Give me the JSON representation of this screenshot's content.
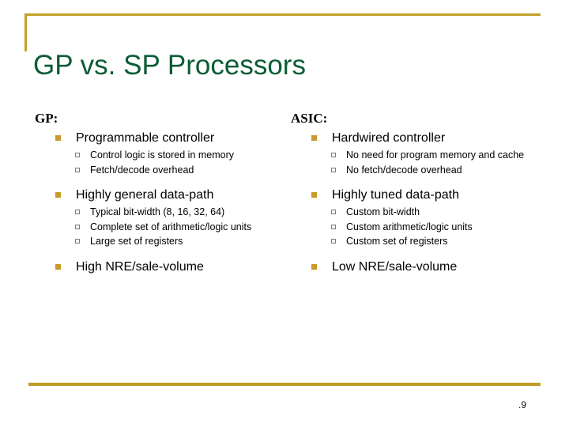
{
  "slide": {
    "title": "GP vs. SP Processors",
    "page_number": ".9",
    "accent_gold": "#C2A02A",
    "title_green": "#0B5C36",
    "bullet_gold": "#C9992B",
    "bullet_outline": "#6E8A6A"
  },
  "columns": {
    "left": {
      "heading": "GP:",
      "groups": [
        {
          "title": "Programmable controller",
          "subs": [
            "Control logic is stored in memory",
            "Fetch/decode overhead"
          ]
        },
        {
          "title": "Highly general data-path",
          "subs": [
            "Typical bit-width (8, 16, 32, 64)",
            "Complete set of arithmetic/logic units",
            "Large set of registers"
          ]
        },
        {
          "title": "High NRE/sale-volume",
          "subs": []
        }
      ]
    },
    "right": {
      "heading": "ASIC:",
      "groups": [
        {
          "title": "Hardwired controller",
          "subs": [
            "No need for program memory and cache",
            "No fetch/decode overhead"
          ]
        },
        {
          "title": "Highly tuned data-path",
          "subs": [
            "Custom  bit-width",
            "Custom arithmetic/logic units",
            "Custom set of registers"
          ]
        },
        {
          "title": "Low NRE/sale-volume",
          "subs": []
        }
      ]
    }
  }
}
